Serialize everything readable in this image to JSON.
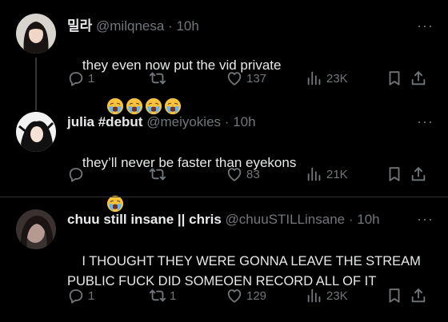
{
  "tweets": [
    {
      "name": "밀라",
      "handle": "@milqnesa",
      "time": "10h",
      "text": "they even now put the vid private",
      "emoji_count": 4,
      "replies": "1",
      "retweets": "",
      "likes": "137",
      "views": "23K"
    },
    {
      "name": "julia #debut",
      "handle": "@meiyokies",
      "time": "10h",
      "text": "they’ll never be faster than eyekons",
      "emoji_count": 1,
      "replies": "",
      "retweets": "",
      "likes": "83",
      "views": "21K"
    },
    {
      "name": "chuu still insane || chris",
      "handle": "@chuuSTILLinsane",
      "time": "10h",
      "text": "I THOUGHT THEY WERE GONNA LEAVE THE STREAM PUBLIC FUCK DID SOMEOEN RECORD ALL OF IT",
      "emoji_count": 0,
      "replies": "1",
      "retweets": "1",
      "likes": "129",
      "views": "23K"
    }
  ],
  "separator": "·",
  "more_glyph": "···",
  "icons": {
    "reply": "reply-icon",
    "retweet": "retweet-icon",
    "like": "heart-icon",
    "views": "views-icon",
    "bookmark": "bookmark-icon",
    "share": "share-icon",
    "emoji": "loudly-crying-face-emoji"
  },
  "colors": {
    "background": "#000000",
    "text": "#e7e9ea",
    "muted": "#71767b",
    "divider": "#2f3336",
    "emoji_yellow": "#f9c23c"
  }
}
